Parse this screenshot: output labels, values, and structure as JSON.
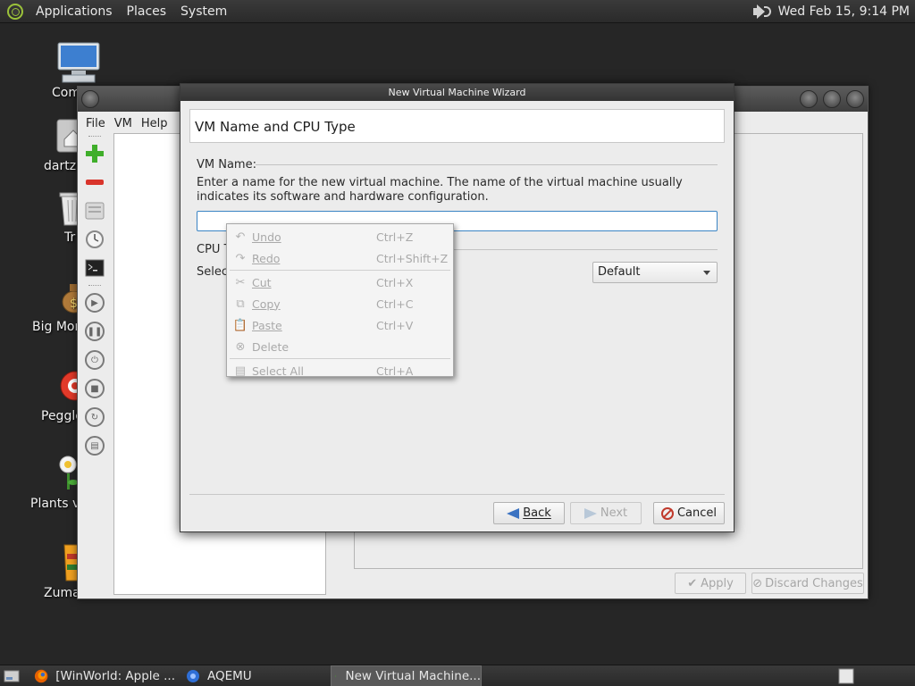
{
  "top_panel": {
    "menus": [
      "Applications",
      "Places",
      "System"
    ],
    "clock": "Wed Feb 15,  9:14 PM",
    "icons": [
      "gnome-foot-icon",
      "volume-icon"
    ]
  },
  "desktop": {
    "icons": [
      {
        "label": "Com",
        "icon": "computer-icon"
      },
      {
        "label": "dartz'",
        "icon": "home-folder-icon"
      },
      {
        "label": "Tr",
        "icon": "trash-icon"
      },
      {
        "label": "Big Mon",
        "icon": "money-bag-icon"
      },
      {
        "label": "Peggle",
        "icon": "peggle-icon"
      },
      {
        "label": "Plants vs",
        "icon": "plants-icon"
      },
      {
        "label": "Zuma",
        "icon": "zuma-icon"
      }
    ]
  },
  "aqemu": {
    "menus": [
      "File",
      "VM",
      "Help"
    ],
    "buttons": {
      "apply": "Apply",
      "discard": "Discard Changes"
    },
    "toolbar_icons": [
      "add-vm-icon",
      "remove-vm-icon",
      "settings-icon",
      "clock-icon",
      "terminal-icon",
      "play-icon",
      "pause-icon",
      "power-icon",
      "stop-icon",
      "reset-icon",
      "save-icon"
    ]
  },
  "wizard": {
    "title": "New Virtual Machine Wizard",
    "header": "VM Name and CPU Type",
    "vm_name_label": "VM Name:",
    "description": "Enter a name for the new virtual machine. The name of the virtual machine usually indicates its software and hardware configuration.",
    "vm_name_value": "",
    "cpu_label": "CPU T",
    "select_label": "Select",
    "cpu_select_value": "Default",
    "buttons": {
      "back": "Back",
      "next": "Next",
      "cancel": "Cancel"
    }
  },
  "context_menu": {
    "items": [
      {
        "label": "Undo",
        "accel": "Ctrl+Z",
        "icon": "undo-icon"
      },
      {
        "label": "Redo",
        "accel": "Ctrl+Shift+Z",
        "icon": "redo-icon"
      },
      {
        "label": "Cut",
        "accel": "Ctrl+X",
        "icon": "cut-icon"
      },
      {
        "label": "Copy",
        "accel": "Ctrl+C",
        "icon": "copy-icon"
      },
      {
        "label": "Paste",
        "accel": "Ctrl+V",
        "icon": "paste-icon"
      },
      {
        "label": "Delete",
        "accel": "",
        "icon": "delete-icon"
      },
      {
        "label": "Select All",
        "accel": "Ctrl+A",
        "icon": "select-all-icon"
      }
    ]
  },
  "taskbar": {
    "tasks": [
      {
        "label": "[WinWorld: Apple ...",
        "icon": "firefox-icon"
      },
      {
        "label": "AQEMU",
        "icon": "aqemu-icon"
      },
      {
        "label": "New Virtual Machine...",
        "icon": "add-vm-icon"
      }
    ]
  },
  "colors": {
    "desktop_bg": "#262626",
    "panel_bg": "#333333",
    "window_bg": "#ececec",
    "input_focus": "#3a84c4",
    "disabled_text": "#a9a9a9"
  }
}
